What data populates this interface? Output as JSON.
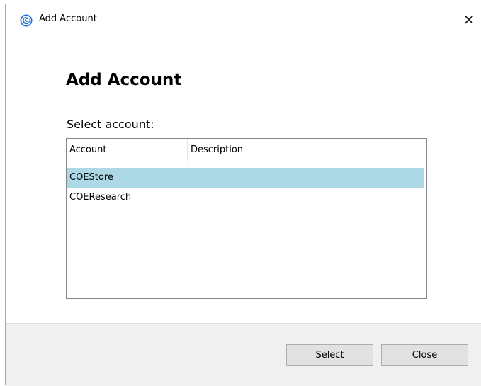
{
  "window": {
    "title": "Add Account",
    "close_glyph": "✕"
  },
  "main": {
    "heading": "Add Account",
    "prompt": "Select account:"
  },
  "list": {
    "columns": [
      "Account",
      "Description"
    ],
    "rows": [
      {
        "account": "COEStore",
        "description": "",
        "selected": true
      },
      {
        "account": "COEResearch",
        "description": "",
        "selected": false
      }
    ]
  },
  "buttons": {
    "select_label": "Select",
    "close_label": "Close"
  },
  "colors": {
    "selection": "#add8e6",
    "icon_blue": "#1e6fd9"
  }
}
